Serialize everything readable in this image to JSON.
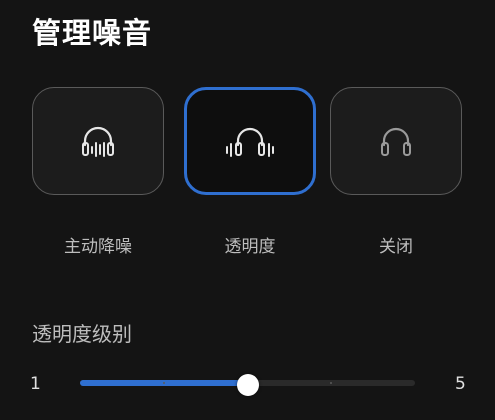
{
  "page": {
    "title": "管理噪音"
  },
  "modes": [
    {
      "label": "主动降噪",
      "icon": "anc-headphones-icon",
      "selected": false
    },
    {
      "label": "透明度",
      "icon": "transparency-headphones-icon",
      "selected": true
    },
    {
      "label": "关闭",
      "icon": "headphones-icon",
      "selected": false
    }
  ],
  "transparency": {
    "label": "透明度级别",
    "min_label": "1",
    "max_label": "5",
    "min": 1,
    "max": 5,
    "value": 3
  },
  "colors": {
    "accent": "#2f6fd0",
    "background": "#141414",
    "label_text": "#bdbdbd"
  }
}
